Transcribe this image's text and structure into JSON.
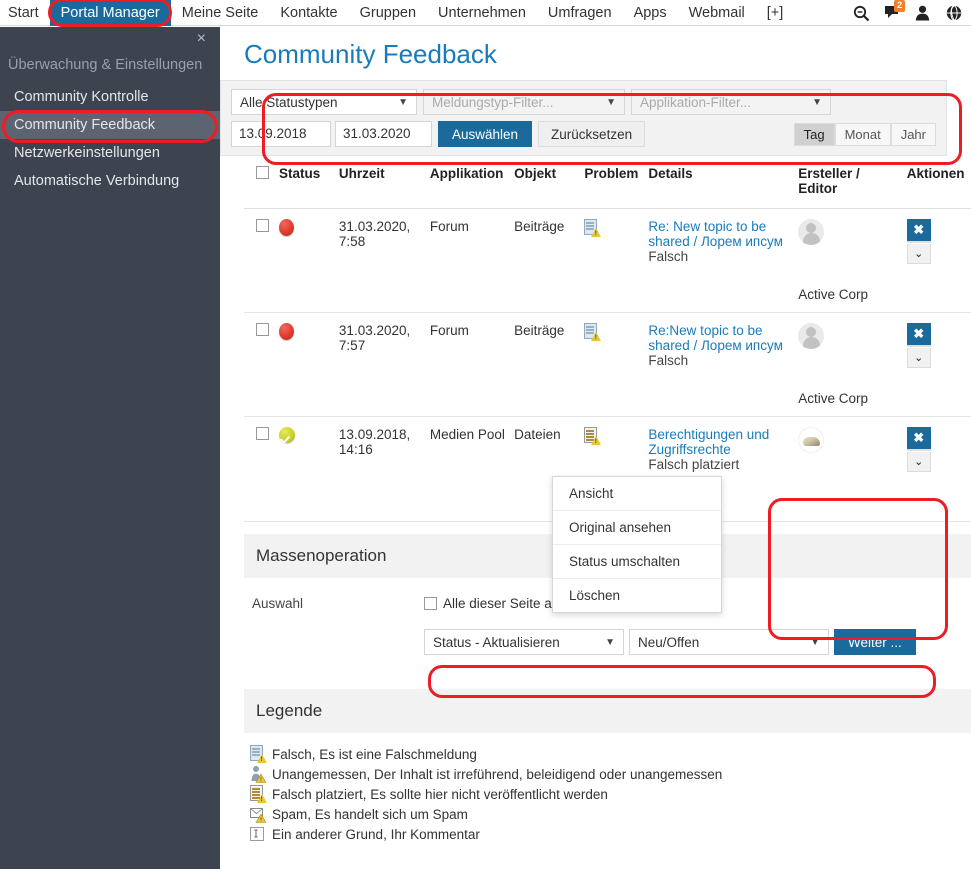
{
  "topnav": {
    "items": [
      {
        "label": "Start",
        "active": false
      },
      {
        "label": "Portal Manager",
        "active": true
      },
      {
        "label": "Meine Seite",
        "active": false
      },
      {
        "label": "Kontakte",
        "active": false
      },
      {
        "label": "Gruppen",
        "active": false
      },
      {
        "label": "Unternehmen",
        "active": false
      },
      {
        "label": "Umfragen",
        "active": false
      },
      {
        "label": "Apps",
        "active": false
      },
      {
        "label": "Webmail",
        "active": false
      },
      {
        "label": "[+]",
        "active": false
      }
    ],
    "icons": [
      "search-icon",
      "messages-icon",
      "user-icon",
      "globe-icon"
    ],
    "message_badge": "2"
  },
  "sidebar": {
    "close_label": "×",
    "title": "Überwachung & Einstellungen",
    "items": [
      {
        "label": "Community Kontrolle",
        "selected": false
      },
      {
        "label": "Community Feedback",
        "selected": true
      },
      {
        "label": "Netzwerkeinstellungen",
        "selected": false
      },
      {
        "label": "Automatische Verbindung",
        "selected": false
      }
    ]
  },
  "page": {
    "title": "Community Feedback"
  },
  "filters": {
    "status_select": "Alle Statustypen",
    "type_select_placeholder": "Meldungstyp-Filter...",
    "app_select_placeholder": "Applikation-Filter...",
    "date_from": "13.09.2018",
    "date_to": "31.03.2020",
    "apply_button": "Auswählen",
    "reset_button": "Zurücksetzen",
    "range": [
      {
        "label": "Tag",
        "active": true
      },
      {
        "label": "Monat",
        "active": false
      },
      {
        "label": "Jahr",
        "active": false
      }
    ]
  },
  "table": {
    "columns": [
      "Status",
      "Uhrzeit",
      "Applikation",
      "Objekt",
      "Problem",
      "Details",
      "Ersteller / Editor",
      "Aktionen"
    ],
    "header_ersteller_line1": "Ersteller /",
    "header_ersteller_line2": "Editor",
    "rows": [
      {
        "status": "red",
        "time": "31.03.2020, 7:58",
        "application": "Forum",
        "object": "Beiträge",
        "problem_icon": "falsch-icon",
        "detail_link": "Re: New topic to be shared / Лорем ипсум",
        "detail_reason": "Falsch",
        "creator": "Active Corp",
        "avatar": "placeholder"
      },
      {
        "status": "red",
        "time": "31.03.2020, 7:57",
        "application": "Forum",
        "object": "Beiträge",
        "problem_icon": "falsch-icon",
        "detail_link": "Re:New topic to be shared / Лорем ипсум",
        "detail_reason": "Falsch",
        "creator": "Active Corp",
        "avatar": "placeholder"
      },
      {
        "status": "green",
        "time": "13.09.2018, 14:16",
        "application": "Medien Pool",
        "object": "Dateien",
        "problem_icon": "falsch-platziert-icon",
        "detail_link": "Berechtigungen und Zugriffsrechte",
        "detail_reason": "Falsch platziert",
        "creator": "",
        "avatar": "photo"
      }
    ],
    "action_delete_label": "✖",
    "action_more_label": "⌄"
  },
  "context_menu": {
    "items": [
      "Ansicht",
      "Original ansehen",
      "Status umschalten",
      "Löschen"
    ]
  },
  "bulk": {
    "heading": "Massenoperation",
    "label": "Auswahl",
    "select_all_label": "Alle dieser Seite auswählen",
    "action_select": "Status - Aktualisieren",
    "value_select": "Neu/Offen",
    "submit_button": "Weiter ..."
  },
  "legend": {
    "heading": "Legende",
    "items": [
      {
        "icon": "falsch-icon",
        "text": "Falsch, Es ist eine Falschmeldung"
      },
      {
        "icon": "unangemessen-icon",
        "text": "Unangemessen, Der Inhalt ist irreführend, beleidigend oder unangemessen"
      },
      {
        "icon": "falsch-platziert-icon",
        "text": "Falsch platziert, Es sollte hier nicht veröffentlicht werden"
      },
      {
        "icon": "spam-icon",
        "text": "Spam, Es handelt sich um Spam"
      },
      {
        "icon": "anderer-grund-icon",
        "text": "Ein anderer Grund, Ihr Kommentar"
      }
    ]
  },
  "colors": {
    "accent": "#1a7bb9",
    "button_blue": "#1a6a9b",
    "annotation_red": "#ee1c25",
    "sidebar_bg": "#3d4450",
    "status_red": "#e03a2c",
    "status_green": "#c8cf2c"
  }
}
